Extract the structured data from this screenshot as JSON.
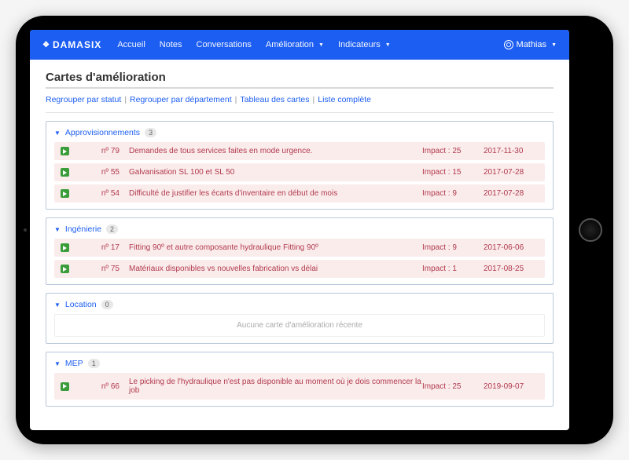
{
  "brand": "DAMASIX",
  "nav": {
    "items": [
      "Accueil",
      "Notes",
      "Conversations",
      "Amélioration",
      "Indicateurs"
    ],
    "dropdown_indices": [
      3,
      4
    ]
  },
  "user": {
    "name": "Mathias"
  },
  "page": {
    "title": "Cartes d'amélioration",
    "subnav": [
      "Regrouper par statut",
      "Regrouper par département",
      "Tableau des cartes",
      "Liste complète"
    ],
    "empty_text": "Aucune carte d'amélioration récente",
    "impact_prefix": "Impact : ",
    "num_prefix": "nº "
  },
  "groups": [
    {
      "name": "Approvisionnements",
      "count": "3",
      "cards": [
        {
          "num": "79",
          "title": "Demandes de tous services faites en mode urgence.",
          "impact": "25",
          "date": "2017-11-30"
        },
        {
          "num": "55",
          "title": "Galvanisation SL 100 et SL 50",
          "impact": "15",
          "date": "2017-07-28"
        },
        {
          "num": "54",
          "title": "Difficulté de justifier les écarts d'inventaire en début de mois",
          "impact": "9",
          "date": "2017-07-28"
        }
      ]
    },
    {
      "name": "Ingénierie",
      "count": "2",
      "cards": [
        {
          "num": "17",
          "title": "Fitting 90º et autre composante hydraulique Fitting 90º",
          "impact": "9",
          "date": "2017-06-06"
        },
        {
          "num": "75",
          "title": "Matériaux disponibles vs nouvelles fabrication vs délai",
          "impact": "1",
          "date": "2017-08-25"
        }
      ]
    },
    {
      "name": "Location",
      "count": "0",
      "cards": []
    },
    {
      "name": "MEP",
      "count": "1",
      "cards": [
        {
          "num": "66",
          "title": "Le picking de l'hydraulique n'est pas disponible au moment où je dois commencer la job",
          "impact": "25",
          "date": "2019-09-07"
        }
      ]
    }
  ]
}
